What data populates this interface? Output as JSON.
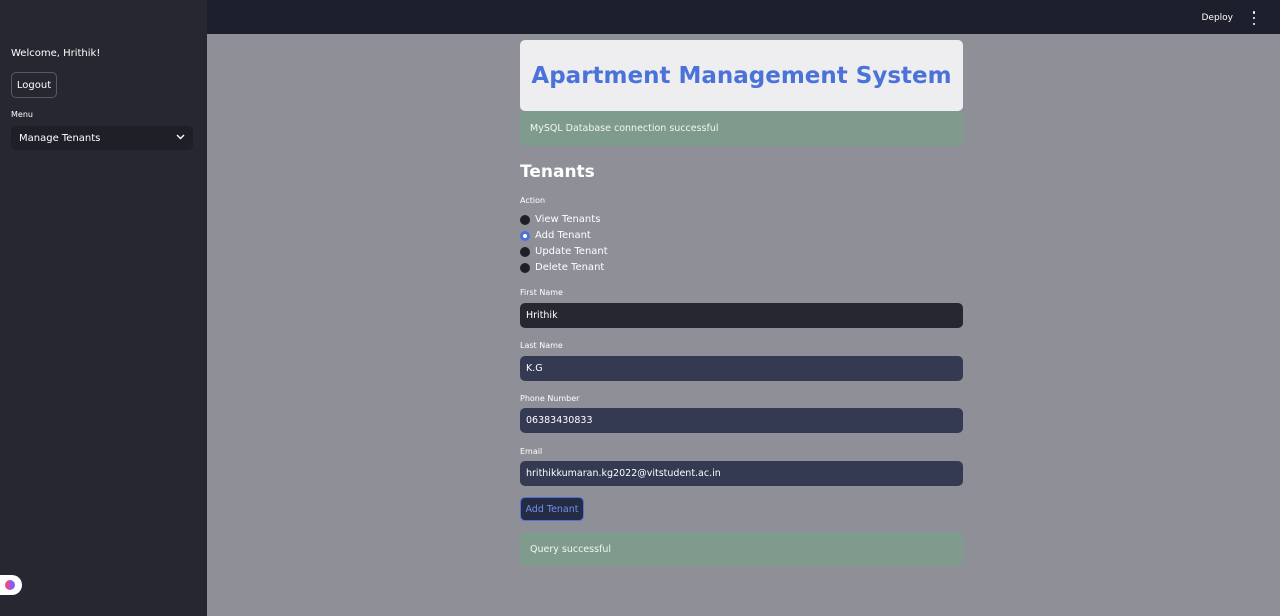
{
  "sidebar": {
    "welcome": "Welcome, Hrithik!",
    "logout_label": "Logout",
    "menu_label": "Menu",
    "menu_selected": "Manage Tenants"
  },
  "topbar": {
    "deploy_label": "Deploy"
  },
  "main": {
    "title": "Apartment Management System",
    "db_status": "MySQL Database connection successful",
    "section_title": "Tenants",
    "action_label": "Action",
    "actions": [
      "View Tenants",
      "Add Tenant",
      "Update Tenant",
      "Delete Tenant"
    ],
    "selected_action": "Add Tenant",
    "form": {
      "first_name_label": "First Name",
      "first_name_value": "Hrithik",
      "last_name_label": "Last Name",
      "last_name_value": "K.G",
      "phone_label": "Phone Number",
      "phone_value": "06383430833",
      "email_label": "Email",
      "email_value": "hrithikkumaran.kg2022@vitstudent.ac.in",
      "submit_label": "Add Tenant"
    },
    "query_status": "Query successful"
  },
  "colors": {
    "accent": "#4a72d9",
    "sidebar_bg": "#262730",
    "success_bg": "#7f9b8d"
  }
}
